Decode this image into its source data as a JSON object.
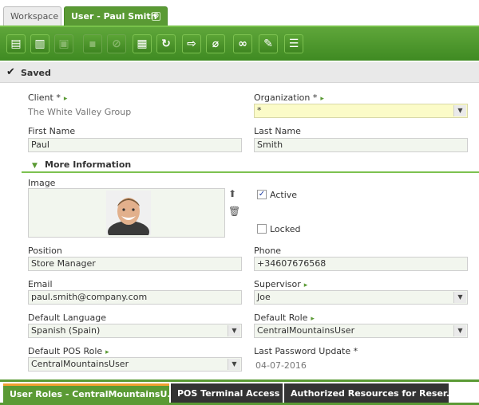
{
  "tabs": {
    "workspace": "Workspace",
    "user": "User - Paul Smith",
    "close_glyph": "⊗"
  },
  "toolbar": {
    "icons": [
      "new-document-icon",
      "save-layout-icon",
      "save-icon",
      "export-icon",
      "cancel-icon",
      "delete-icon",
      "refresh-icon",
      "print-icon",
      "attach-icon",
      "link-icon",
      "tools-icon",
      "grid-icon"
    ]
  },
  "status": {
    "text": "Saved",
    "check": "✔"
  },
  "form": {
    "client_label": "Client *",
    "client_value": "The White Valley Group",
    "organization_label": "Organization *",
    "organization_value": "*",
    "first_name_label": "First Name",
    "first_name_value": "Paul",
    "last_name_label": "Last Name",
    "last_name_value": "Smith",
    "more_info_label": "More Information",
    "image_label": "Image",
    "active_label": "Active",
    "locked_label": "Locked",
    "position_label": "Position",
    "position_value": "Store Manager",
    "phone_label": "Phone",
    "phone_value": "+34607676568",
    "email_label": "Email",
    "email_value": "paul.smith@company.com",
    "supervisor_label": "Supervisor",
    "supervisor_value": "Joe",
    "default_language_label": "Default Language",
    "default_language_value": "Spanish (Spain)",
    "default_role_label": "Default Role",
    "default_role_value": "CentralMountainsUser",
    "default_pos_role_label": "Default POS Role",
    "default_pos_role_value": "CentralMountainsUser",
    "last_password_update_label": "Last Password Update *",
    "last_password_update_value": "04-07-2016",
    "active_checked": true,
    "locked_checked": false
  },
  "bottom_tabs": {
    "user_roles": "User Roles - CentralMountainsU...",
    "pos_terminal": "POS Terminal Access",
    "authorized": "Authorized Resources for Reser..."
  },
  "colors": {
    "accent_green": "#5a9a34",
    "dark_tab": "#333333",
    "highlight_yellow": "#fbfbc8"
  }
}
